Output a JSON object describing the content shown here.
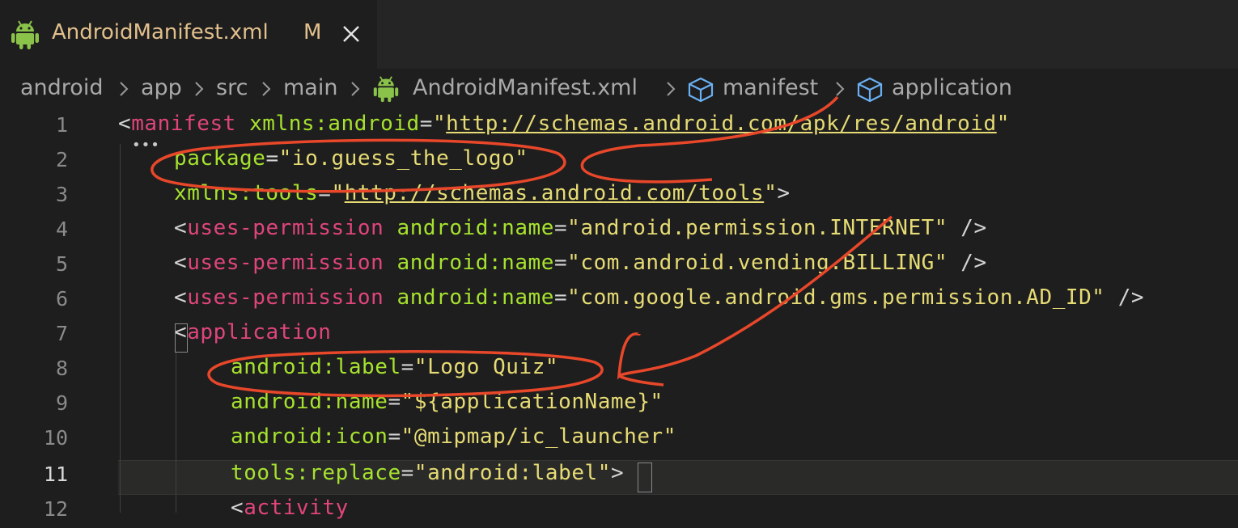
{
  "tab": {
    "filename": "AndroidManifest.xml",
    "status": "M",
    "icon": "android-icon",
    "close_icon": "close-icon"
  },
  "breadcrumbs": [
    {
      "label": "android"
    },
    {
      "label": "app"
    },
    {
      "label": "src"
    },
    {
      "label": "main"
    },
    {
      "label": "AndroidManifest.xml",
      "icon": "android-icon"
    },
    {
      "label": "manifest",
      "icon": "symbol-cube-icon"
    },
    {
      "label": "application",
      "icon": "symbol-cube-icon"
    }
  ],
  "editor": {
    "active_line": 11,
    "lines": [
      {
        "number": "1",
        "segments": [
          [
            "punc",
            "<"
          ],
          [
            "tag",
            "manifest"
          ],
          [
            "punc",
            " "
          ],
          [
            "attr",
            "xmlns:android"
          ],
          [
            "punc",
            "="
          ],
          [
            "str",
            "\""
          ],
          [
            "url",
            "http://schemas.android.com/apk/res/android"
          ],
          [
            "str",
            "\""
          ]
        ]
      },
      {
        "number": "2",
        "segments": [
          [
            "attr",
            "package"
          ],
          [
            "punc",
            "="
          ],
          [
            "str",
            "\"io.guess_the_logo\""
          ]
        ]
      },
      {
        "number": "3",
        "segments": [
          [
            "attr",
            "xmlns:tools"
          ],
          [
            "punc",
            "="
          ],
          [
            "str",
            "\""
          ],
          [
            "url",
            "http://schemas.android.com/tools"
          ],
          [
            "str",
            "\""
          ],
          [
            "punc",
            ">"
          ]
        ]
      },
      {
        "number": "4",
        "segments": [
          [
            "punc",
            "<"
          ],
          [
            "tag",
            "uses-permission"
          ],
          [
            "punc",
            " "
          ],
          [
            "attr",
            "android:name"
          ],
          [
            "punc",
            "="
          ],
          [
            "str",
            "\"android.permission.INTERNET\""
          ],
          [
            "punc",
            " />"
          ]
        ]
      },
      {
        "number": "5",
        "segments": [
          [
            "punc",
            "<"
          ],
          [
            "tag",
            "uses-permission"
          ],
          [
            "punc",
            " "
          ],
          [
            "attr",
            "android:name"
          ],
          [
            "punc",
            "="
          ],
          [
            "str",
            "\"com.android.vending.BILLING\""
          ],
          [
            "punc",
            " />"
          ]
        ]
      },
      {
        "number": "6",
        "segments": [
          [
            "punc",
            "<"
          ],
          [
            "tag",
            "uses-permission"
          ],
          [
            "punc",
            " "
          ],
          [
            "attr",
            "android:name"
          ],
          [
            "punc",
            "="
          ],
          [
            "str",
            "\"com.google.android.gms.permission.AD_ID\""
          ],
          [
            "punc",
            " />"
          ]
        ]
      },
      {
        "number": "7",
        "segments": [
          [
            "punc",
            "<"
          ],
          [
            "tag",
            "application"
          ]
        ]
      },
      {
        "number": "8",
        "segments": [
          [
            "attr",
            "android:label"
          ],
          [
            "punc",
            "="
          ],
          [
            "str",
            "\"Logo Quiz\""
          ]
        ]
      },
      {
        "number": "9",
        "segments": [
          [
            "attr",
            "android:name"
          ],
          [
            "punc",
            "="
          ],
          [
            "str",
            "\"${applicationName}\""
          ]
        ]
      },
      {
        "number": "10",
        "segments": [
          [
            "attr",
            "android:icon"
          ],
          [
            "punc",
            "="
          ],
          [
            "str",
            "\"@mipmap/ic_launcher\""
          ]
        ]
      },
      {
        "number": "11",
        "segments": [
          [
            "attr",
            "tools:replace"
          ],
          [
            "punc",
            "="
          ],
          [
            "str",
            "\"android:label\""
          ],
          [
            "punc",
            ">"
          ]
        ]
      },
      {
        "number": "12",
        "segments": [
          [
            "punc",
            "<"
          ],
          [
            "tag",
            "activity"
          ]
        ]
      }
    ]
  },
  "colors": {
    "tag": "#e0457b",
    "attribute": "#a6e22e",
    "string": "#e6db74",
    "modified": "#e2c08d",
    "annotation": "#e8472a"
  }
}
